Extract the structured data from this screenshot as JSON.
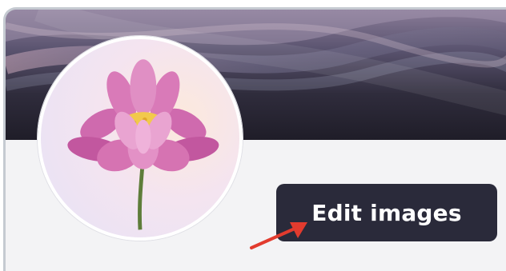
{
  "profile": {
    "cover_icon": "abstract-wave-cover",
    "avatar_icon": "lotus-flower-avatar",
    "edit_button_label": "Edit images"
  },
  "colors": {
    "button_bg": "#2a2a3a",
    "button_text": "#ffffff",
    "arrow": "#e23b2e",
    "card_border": "#c5cad1"
  },
  "annotation": {
    "arrow_icon": "red-pointer-arrow-icon"
  }
}
